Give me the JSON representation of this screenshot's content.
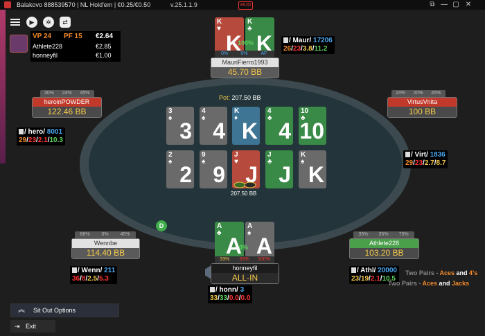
{
  "window": {
    "title": "Balakovo 888539570  |  NL Hold'em  |  €0.25/€0.50",
    "version": "v.25.1.1.9",
    "hud_badge": "HUD"
  },
  "info_panel": {
    "vp": "VP 24",
    "pf": "PF 15",
    "amount": "€2.64",
    "rows": [
      {
        "name": "Athlete228",
        "value": "€2.85"
      },
      {
        "name": "honneyfil",
        "value": "€1.00"
      }
    ]
  },
  "pot": {
    "label": "Pot:",
    "value": "207.50 BB"
  },
  "chips_amount": "207.50 BB",
  "board": {
    "row1": [
      {
        "rank": "3",
        "suit": "♠",
        "color": "grey"
      },
      {
        "rank": "4",
        "suit": "♠",
        "color": "grey"
      },
      {
        "rank": "K",
        "suit": "♦",
        "color": "blue"
      },
      {
        "rank": "4",
        "suit": "♣",
        "color": "green"
      },
      {
        "rank": "10",
        "suit": "♣",
        "color": "green"
      }
    ],
    "row2": [
      {
        "rank": "2",
        "suit": "♠",
        "color": "grey"
      },
      {
        "rank": "9",
        "suit": "♠",
        "color": "grey"
      },
      {
        "rank": "J",
        "suit": "♥",
        "color": "red"
      },
      {
        "rank": "J",
        "suit": "♣",
        "color": "green"
      },
      {
        "rank": "K",
        "suit": "♠",
        "color": "grey"
      }
    ]
  },
  "players": {
    "top": {
      "name": "MauriFierro1993",
      "stack": "45.70 BB",
      "cards": [
        {
          "rank": "K",
          "suit": "♥"
        },
        {
          "rank": "K",
          "suit": "♣"
        }
      ],
      "equity": "100%",
      "bar": [
        "0%",
        "0%",
        "AF"
      ],
      "hud": {
        "tag": "/ Maur/",
        "hands": "17206",
        "stats": [
          "26",
          "23",
          "3.8",
          "11.2"
        ]
      }
    },
    "left_upper": {
      "name": "heroinPOWDER",
      "stack": "122.46 BB",
      "bar": [
        "30%",
        "24%",
        "45%"
      ],
      "hud": {
        "tag": "/ hero/",
        "hands": "8001",
        "stats": [
          "29",
          "23",
          "2.1",
          "10.3"
        ]
      }
    },
    "right_upper": {
      "name": "VirtusVnita",
      "stack": "100 BB",
      "bar": [
        "24%",
        "20%",
        "45%"
      ],
      "hud": {
        "tag": "/ Virt/",
        "hands": "1836",
        "stats": [
          "29",
          "23",
          "2.7",
          "8.7"
        ]
      }
    },
    "left_lower": {
      "name": "Wennbe",
      "stack": "114.40 BB",
      "bar": [
        "66%",
        "0%",
        "45%"
      ],
      "hud": {
        "tag": "/ Wenn/",
        "hands": "211",
        "stats": [
          "36",
          "8",
          "2.5",
          "5.3"
        ]
      }
    },
    "right_lower": {
      "name": "Athlete228",
      "stack": "103.20 BB",
      "bar": [
        "35%",
        "35%",
        "75%"
      ],
      "hud": {
        "tag": "/ Athl/",
        "hands": "20000",
        "stats": [
          "23",
          "19",
          "2.1",
          "10.5"
        ]
      }
    },
    "hero": {
      "name": "honneyfil",
      "stack": "ALL-IN",
      "cards": [
        {
          "rank": "A",
          "suit": "♣"
        },
        {
          "rank": "A",
          "suit": "♠"
        }
      ],
      "equity": "0%",
      "bar": [
        "33%",
        "33%",
        "100%"
      ],
      "hud": {
        "tag": "/ honn/",
        "hands": "3",
        "stats": [
          "33",
          "33",
          "0.0",
          "0.0"
        ]
      }
    }
  },
  "hand_hints": [
    {
      "prefix": "Two Pairs - ",
      "highlight1": "Aces",
      "mid": " and ",
      "highlight2": "4's"
    },
    {
      "prefix": "Two Pairs - ",
      "highlight1": "Aces",
      "mid": " and ",
      "highlight2": "Jacks"
    }
  ],
  "dealer_label": "D",
  "buttons": {
    "sit_out": "Sit Out Options",
    "exit": "Exit"
  },
  "colors": {
    "card_red": "#b64a3c",
    "card_green": "#3a8a47",
    "card_blue": "#3e7494",
    "card_grey": "#6a6a6a",
    "accent_yellow": "#f5c94a",
    "felt": "#23343a"
  }
}
